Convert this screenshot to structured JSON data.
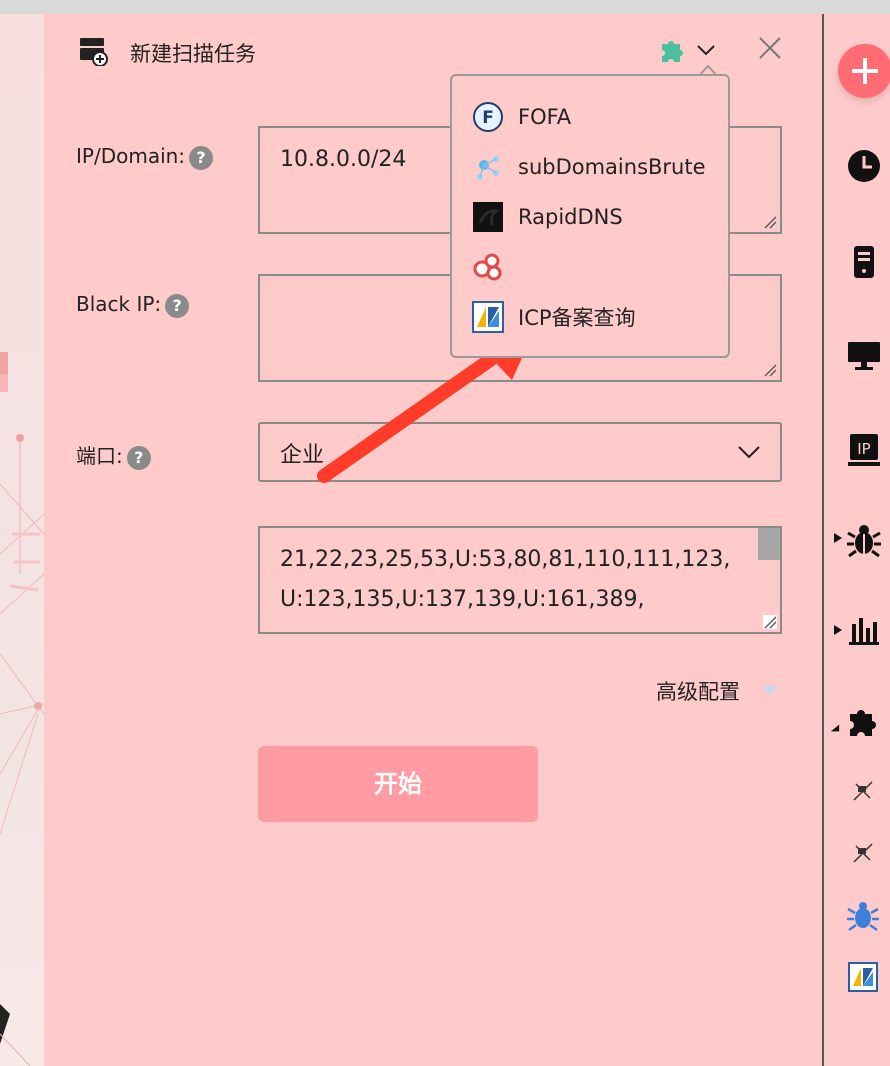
{
  "dialog": {
    "title": "新建扫描任务",
    "close_icon": "close-icon",
    "plugin_icon": "puzzle-icon"
  },
  "form": {
    "ip_domain": {
      "label": "IP/Domain:",
      "value": "10.8.0.0/24"
    },
    "black_ip": {
      "label": "Black IP:",
      "value": ""
    },
    "port": {
      "label": "端口:",
      "selected": "企业",
      "ports": "21,22,23,25,53,U:53,80,81,110,111,123,U:123,135,U:137,139,U:161,389,"
    },
    "help_glyph": "?"
  },
  "advanced": {
    "label": "高级配置"
  },
  "start_button": {
    "label": "开始"
  },
  "plugin_menu": {
    "items": [
      {
        "label": "FOFA",
        "icon": "fofa-icon"
      },
      {
        "label": "subDomainsBrute",
        "icon": "subdomainsbrute-icon"
      },
      {
        "label": "RapidDNS",
        "icon": "rapiddns-icon"
      },
      {
        "label": "",
        "icon": "bubbles-icon"
      },
      {
        "label": "ICP备案查询",
        "icon": "icp-icon"
      }
    ]
  },
  "colors": {
    "panel_bg": "#ffcaca",
    "start_bg": "#ff9ba3",
    "accent": "#ff6b72",
    "arrow": "#ff3b2a"
  }
}
